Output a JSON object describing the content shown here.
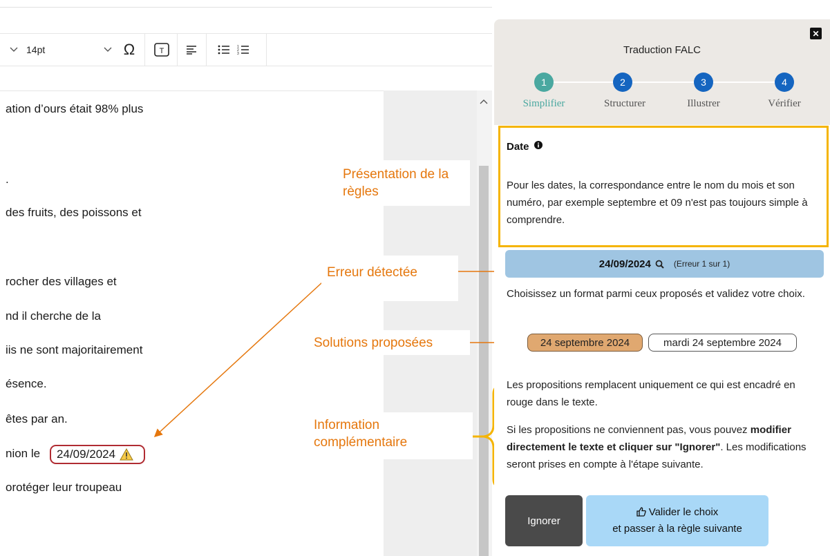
{
  "toolbar": {
    "font_size": "14pt",
    "omega_icon": "omega-special-char-icon",
    "textbox_icon": "textbox-icon",
    "align_icon": "align-left-icon",
    "bullet_icon": "bullet-list-icon",
    "number_icon": "numbered-list-icon"
  },
  "document": {
    "lines": [
      "ation d’ours était 98% plus",
      ".",
      "des fruits, des poissons et",
      "rocher des villages et",
      "nd il cherche de la",
      "iis ne sont majoritairement",
      "ésence.",
      "êtes par an.",
      "nion le",
      "orotéger leur troupeau"
    ],
    "highlighted_date": "24/09/2024"
  },
  "annotations": {
    "rule_presentation": "Présentation de la règles",
    "error_detected": "Erreur détectée",
    "solutions": "Solutions proposées",
    "extra_info": "Information complémentaire",
    "arrow_color": "#e5770d"
  },
  "panel": {
    "title": "Traduction FALC",
    "steps": [
      {
        "number": "1",
        "label": "Simplifier",
        "color": "#4aa8a0"
      },
      {
        "number": "2",
        "label": "Structurer",
        "color": "#1565c0"
      },
      {
        "number": "3",
        "label": "Illustrer",
        "color": "#1565c0"
      },
      {
        "number": "4",
        "label": "Vérifier",
        "color": "#1565c0"
      }
    ],
    "rule": {
      "title": "Date",
      "text": "Pour les dates, la correspondance entre le nom du mois et son numéro, par exemple septembre et 09 n'est pas toujours simple à comprendre."
    },
    "error": {
      "value": "24/09/2024",
      "count": "(Erreur 1 sur 1)"
    },
    "instruction": "Choisissez un format parmi ceux proposés et validez votre choix.",
    "options": [
      "24 septembre 2024",
      "mardi 24 septembre 2024"
    ],
    "info1": "Les propositions remplacent uniquement ce qui est encadré en rouge dans le texte.",
    "info2_pre": "Si les propositions ne conviennent pas, vous pouvez ",
    "info2_bold": "modifier directement le texte et cliquer sur \"Ignorer\"",
    "info2_post": ". Les modifications seront prises en compte à l'étape suivante.",
    "ignore_label": "Ignorer",
    "validate_line1": "Valider le choix",
    "validate_line2": "et passer à la règle suivante"
  },
  "colors": {
    "accent_orange": "#e5770d",
    "rule_border": "#f5b400",
    "error_bar": "#9fc5e2",
    "selected_option": "#e0a870",
    "validate_bg": "#a9d8f7"
  }
}
